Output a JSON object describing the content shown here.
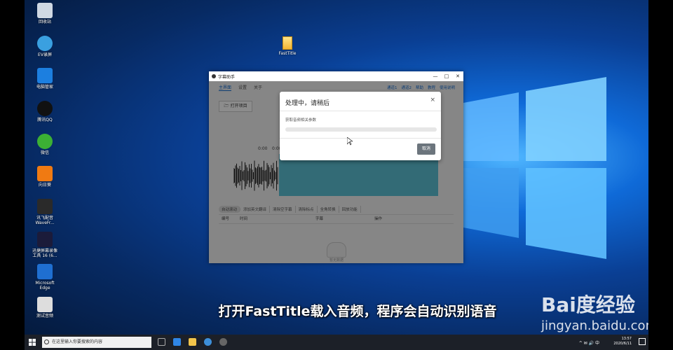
{
  "desktop": {
    "icons": [
      {
        "label": "回收站",
        "color": "#cfd8e3"
      },
      {
        "label": "EV录屏",
        "color": "#3aa0e0"
      },
      {
        "label": "电脑管家",
        "color": "#1c7fe0"
      },
      {
        "label": "腾讯QQ",
        "color": "#111111"
      },
      {
        "label": "微信",
        "color": "#3cb034"
      },
      {
        "label": "向日葵",
        "color": "#f07a12"
      },
      {
        "label": "讯飞配音\nWaveFr...",
        "color": "#2a2a2a"
      },
      {
        "label": "迅捷屏幕录像\n工具 16 (6...",
        "color": "#1b1b3a"
      },
      {
        "label": "Microsoft\nEdge",
        "color": "#1f6fd1"
      },
      {
        "label": "测试音频",
        "color": "#dddddd"
      }
    ],
    "file_icon_label": "FastTitle"
  },
  "app": {
    "title": "字幕助手",
    "controls": {
      "minimize": "—",
      "maximize": "□",
      "close": "✕"
    },
    "tabs": [
      "主界面",
      "设置",
      "关于"
    ],
    "top_links": [
      "通道1",
      "通道2",
      "帮助",
      "教程",
      "使用说明"
    ],
    "open_button": "🗁 打开项目",
    "time_left": "0:00",
    "time_right": "0:00",
    "toggles": [
      "自动滚动",
      "添加英文翻译",
      "清除空字幕",
      "清除标点",
      "全角转换",
      "回放功能"
    ],
    "table_headers": [
      "编号",
      "时间",
      "字幕",
      "操作"
    ],
    "empty_text": "暂无数据"
  },
  "modal": {
    "title": "处理中，请稍后",
    "close": "×",
    "status": "获取音频相关参数",
    "progress": 0,
    "cancel": "取消"
  },
  "subtitle": "打开FastTitle载入音频，程序会自动识别语音",
  "watermark": {
    "logo": "Bai度经验",
    "url": "jingyan.baidu.com"
  },
  "taskbar": {
    "search_placeholder": "在这里输入你要搜索的内容",
    "tray_icons": "^ ✉ 🔊 中",
    "time": "13:57",
    "date": "2020/6/11"
  },
  "colors": {
    "accent": "#1a6fd1",
    "wave_blue": "#5ec3d7",
    "cancel_btn": "#6c757d",
    "taskbar": "#1c2028"
  }
}
